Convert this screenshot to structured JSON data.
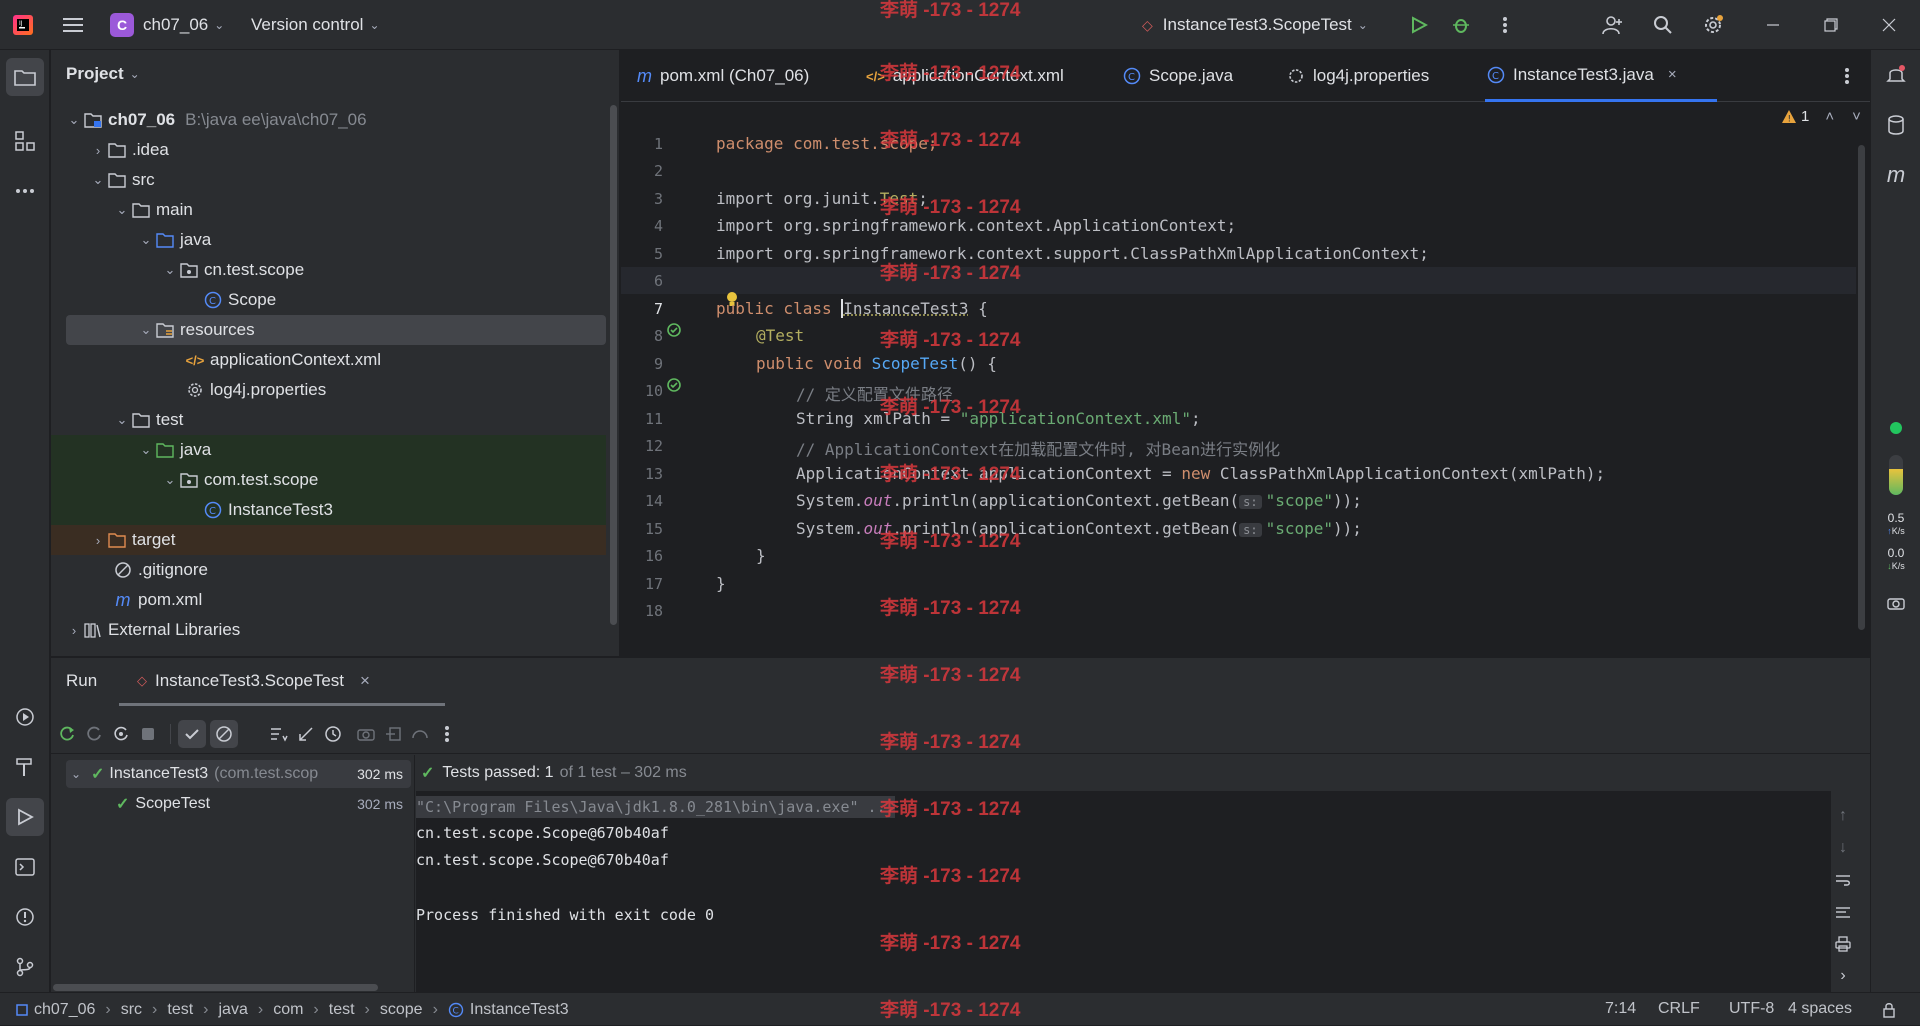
{
  "titlebar": {
    "project_badge": "C",
    "project_name": "ch07_06",
    "vcs": "Version control",
    "run_config": "InstanceTest3.ScopeTest"
  },
  "project_panel": {
    "title": "Project",
    "tree": [
      {
        "label": "ch07_06",
        "hint": "B:\\java ee\\java\\ch07_06"
      },
      {
        "label": ".idea"
      },
      {
        "label": "src"
      },
      {
        "label": "main"
      },
      {
        "label": "java"
      },
      {
        "label": "cn.test.scope"
      },
      {
        "label": "Scope"
      },
      {
        "label": "resources"
      },
      {
        "label": "applicationContext.xml"
      },
      {
        "label": "log4j.properties"
      },
      {
        "label": "test"
      },
      {
        "label": "java"
      },
      {
        "label": "com.test.scope"
      },
      {
        "label": "InstanceTest3"
      },
      {
        "label": "target"
      },
      {
        "label": ".gitignore"
      },
      {
        "label": "pom.xml"
      },
      {
        "label": "External Libraries"
      }
    ]
  },
  "editor": {
    "tabs": [
      "pom.xml (Ch07_06)",
      "applicationContext.xml",
      "Scope.java",
      "log4j.properties",
      "InstanceTest3.java"
    ],
    "warning_count": "1",
    "line_numbers": [
      "1",
      "2",
      "3",
      "4",
      "5",
      "6",
      "7",
      "8",
      "9",
      "10",
      "11",
      "12",
      "13",
      "14",
      "15",
      "16",
      "17",
      "18"
    ],
    "code": {
      "l1": "package com.test.scope;",
      "l3a": "import org.junit.",
      "l3b": "Test",
      "l4": "import org.springframework.context.ApplicationContext;",
      "l5": "import org.springframework.context.support.ClassPathXmlApplicationContext;",
      "l7a": "public class ",
      "l7b": "InstanceTest3",
      " l7c": " {",
      "l8": "@Test",
      "l9a": "public void ",
      "l9b": "ScopeTest",
      "l9c": "() {",
      "l10": "// 定义配置文件路径",
      "l11a": "String xmlPath = ",
      "l11b": "\"applicationContext.xml\"",
      "l11c": ";",
      "l12": "// ApplicationContext在加载配置文件时, 对Bean进行实例化",
      "l13a": "ApplicationContext applicationContext = ",
      "l13b": "new",
      " l13c": " ClassPathXmlApplicationContext(xmlPath);",
      "l14a": "System.",
      "l14b": "out",
      "l14c": ".println(applicationContext.getBean(",
      "hint": "s:",
      "l14d": "\"scope\"",
      "l14e": "));",
      "l16": "}",
      "l17": "}"
    }
  },
  "run_panel": {
    "title": "Run",
    "tab": "InstanceTest3.ScopeTest",
    "tests": [
      {
        "name": "InstanceTest3",
        "pkg": "(com.test.scop",
        "time": "302 ms"
      },
      {
        "name": "ScopeTest",
        "time": "302 ms"
      }
    ],
    "summary_strong": "Tests passed: 1",
    "summary_rest": "of 1 test – 302 ms",
    "console": [
      "\"C:\\Program Files\\Java\\jdk1.8.0_281\\bin\\java.exe\" ...",
      "cn.test.scope.Scope@670b40af",
      "cn.test.scope.Scope@670b40af",
      "",
      "Process finished with exit code 0"
    ]
  },
  "statusbar": {
    "crumbs": [
      "ch07_06",
      "src",
      "test",
      "java",
      "com",
      "test",
      "scope",
      "InstanceTest3"
    ],
    "position": "7:14",
    "line_sep": "CRLF",
    "encoding": "UTF-8",
    "indent": "4 spaces"
  },
  "net": {
    "up": "0.5",
    "down": "0.0",
    "unit": "K/s"
  },
  "watermark": "李萌 -173 - 1274"
}
